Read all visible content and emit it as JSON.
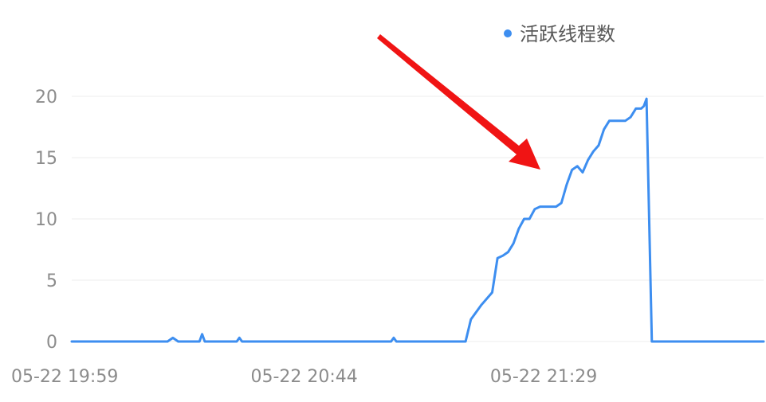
{
  "chart_data": {
    "type": "line",
    "title": "",
    "xlabel": "",
    "ylabel": "",
    "ylim": [
      0,
      20
    ],
    "yticks": [
      0,
      5,
      10,
      15,
      20
    ],
    "grid": true,
    "legend_position": "top-right",
    "xtick_labels": [
      {
        "label": "05-22 19:59",
        "x": 0
      },
      {
        "label": "05-22 20:44",
        "x": 45
      },
      {
        "label": "05-22 21:29",
        "x": 90
      }
    ],
    "series": [
      {
        "name": "活跃线程数",
        "color": "#3d8ef0",
        "x": [
          0,
          18,
          19,
          20,
          24,
          24.5,
          25,
          27,
          31,
          31.5,
          32,
          60,
          60.5,
          61,
          74,
          75,
          77,
          79,
          80,
          81,
          82,
          83,
          84,
          85,
          86,
          87,
          88,
          89,
          90,
          91,
          92,
          93,
          94,
          95,
          96,
          97,
          98,
          99,
          100,
          101,
          102,
          103,
          104,
          105,
          106,
          107,
          107.5,
          108,
          109,
          130
        ],
        "values": [
          0,
          0,
          0.3,
          0,
          0,
          0.6,
          0,
          0,
          0,
          0.3,
          0,
          0,
          0.3,
          0,
          0,
          1.8,
          3,
          4,
          6.8,
          7,
          7.3,
          8,
          9.2,
          10,
          10,
          10.8,
          11,
          11,
          11,
          11,
          11.3,
          12.8,
          14,
          14.3,
          13.8,
          14.8,
          15.5,
          16,
          17.3,
          18,
          18,
          18,
          18,
          18.3,
          19,
          19,
          19.2,
          19.8,
          0,
          0
        ]
      }
    ]
  },
  "annotation": {
    "type": "arrow",
    "color": "#f01414"
  }
}
